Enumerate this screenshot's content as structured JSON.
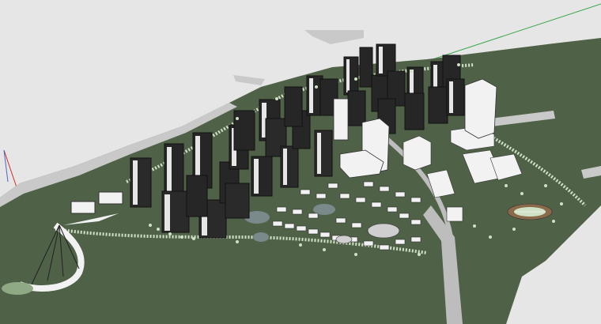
{
  "scene": {
    "kind": "3d-model-viewport",
    "background_color": "#e6e6e6",
    "ground_color": "#4f6147",
    "road_color": "#c9c9c9",
    "tower_light": "#f2f2f2",
    "tower_dark": "#1f1f1f",
    "tree_color": "#cfe0c4",
    "water_color": "#7a8a8a",
    "axis_colors": {
      "red": "#d32a2a",
      "green": "#3aa64a",
      "blue": "#4a67c9"
    }
  }
}
